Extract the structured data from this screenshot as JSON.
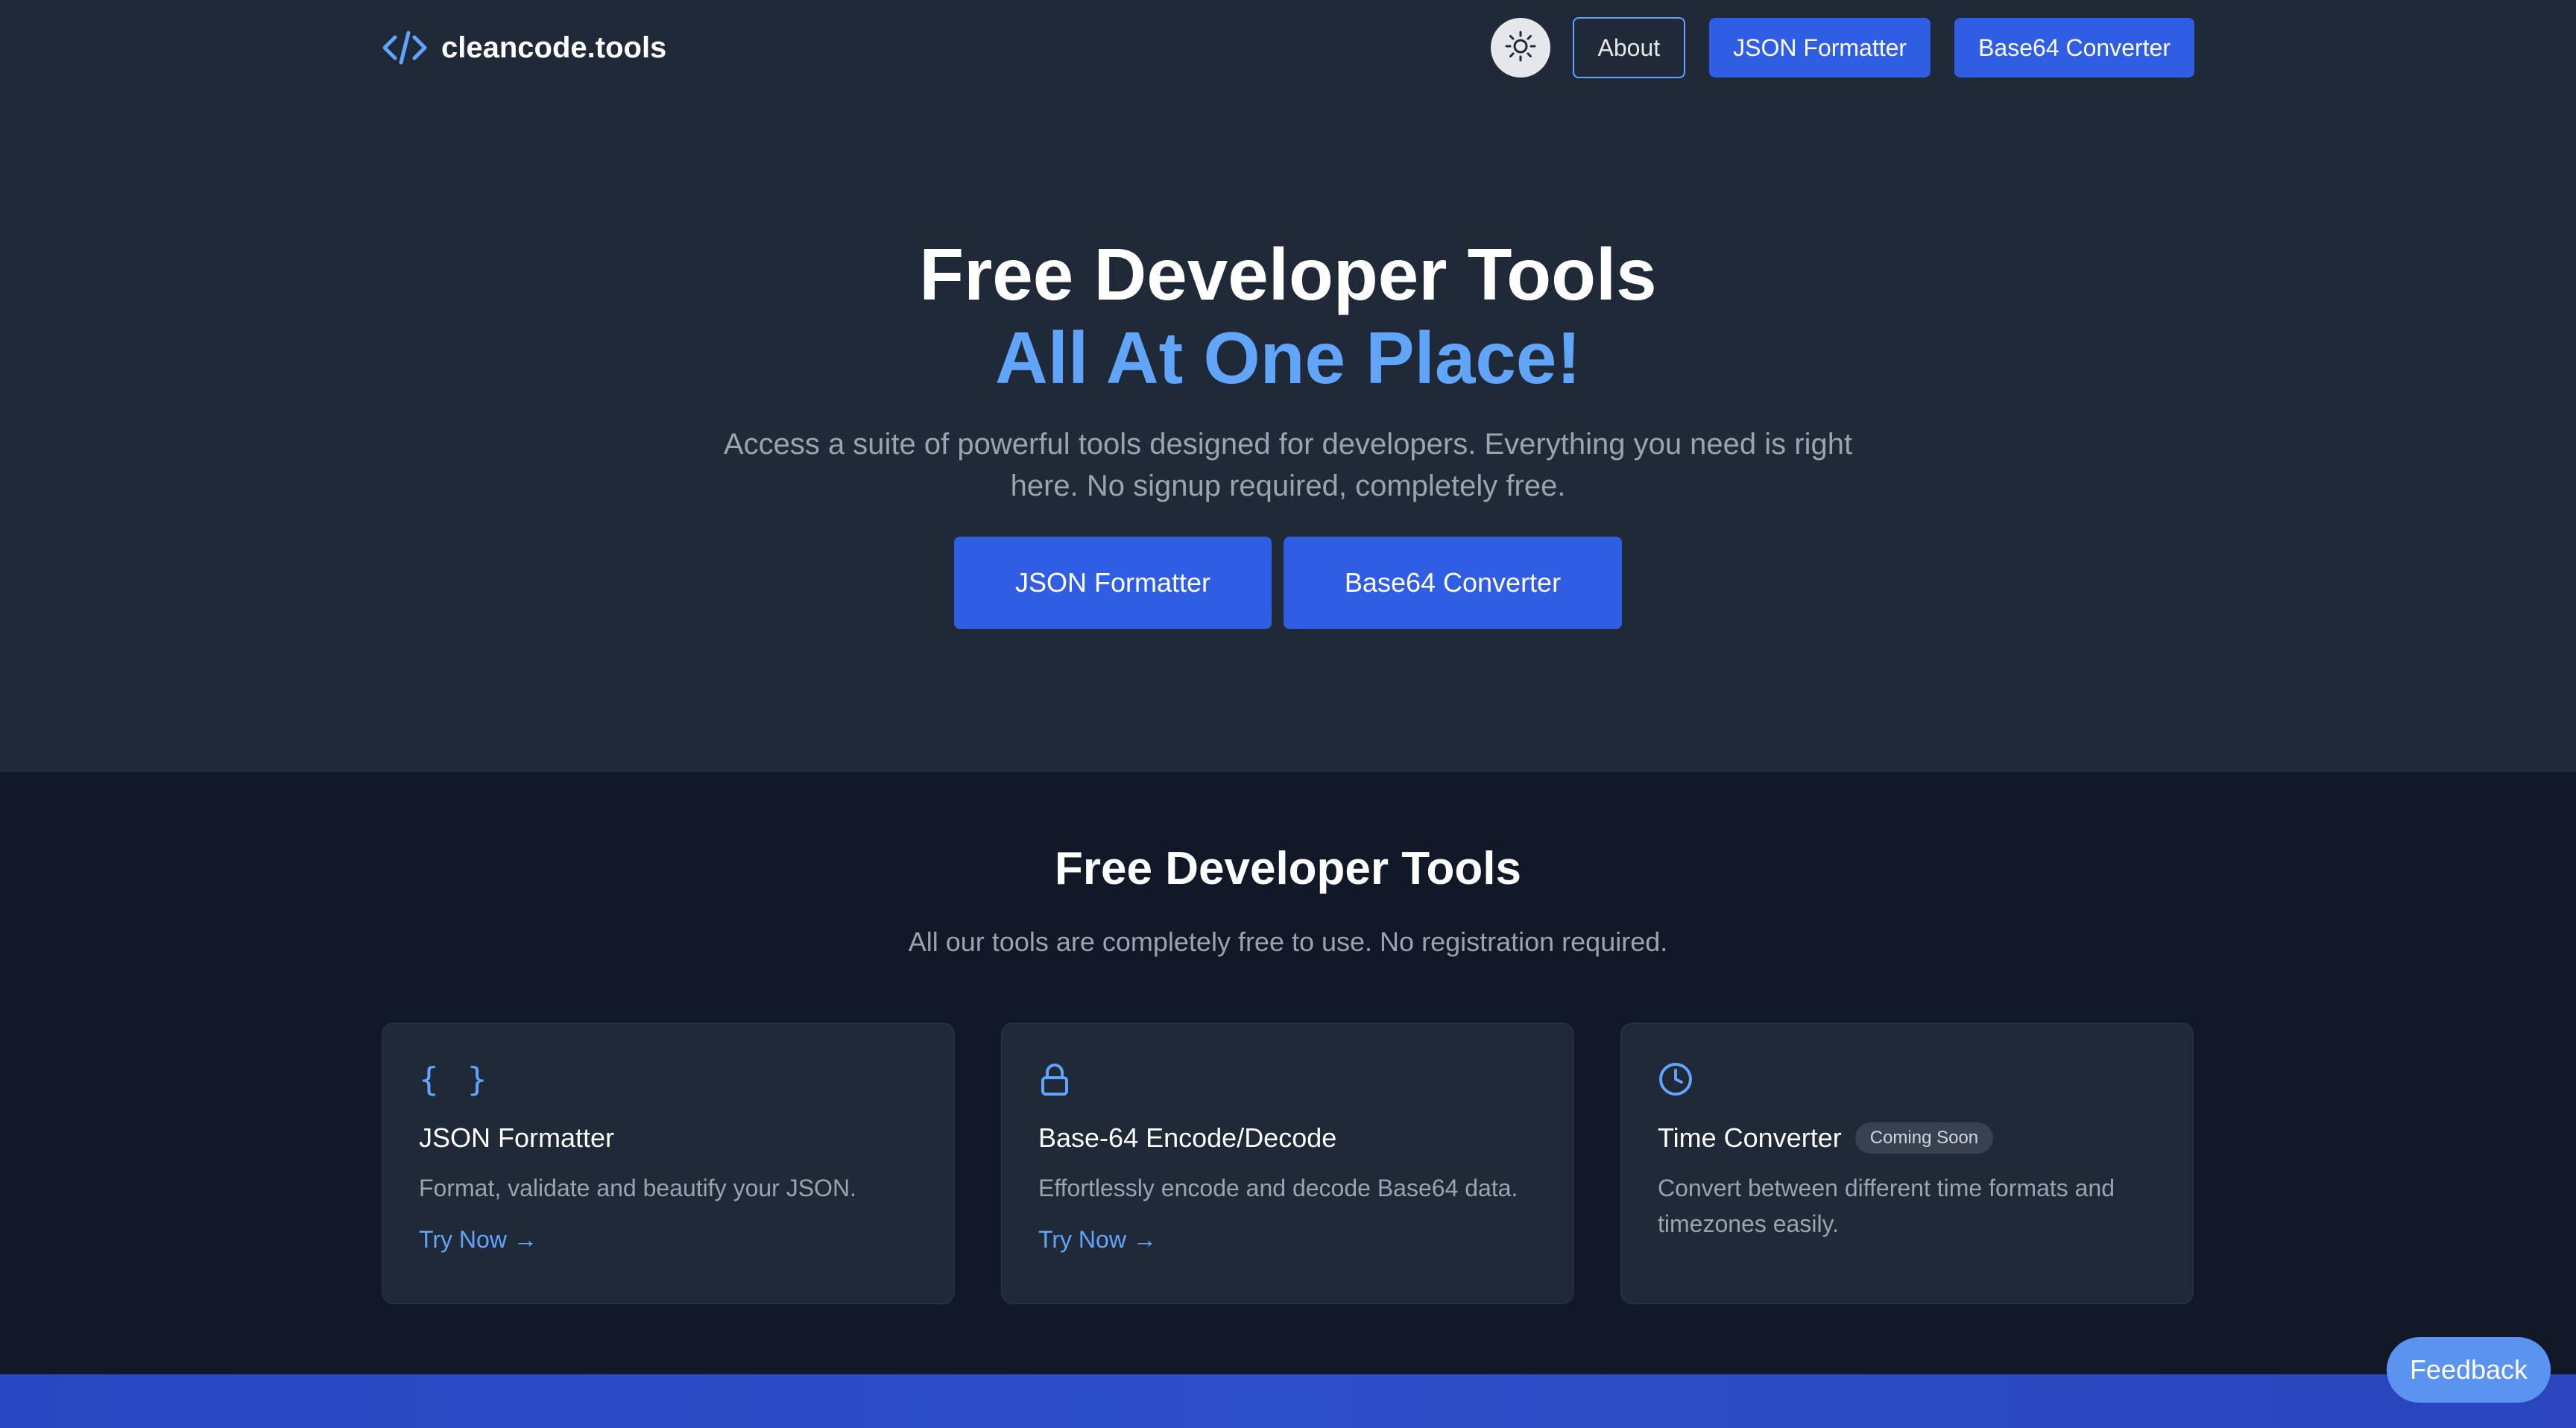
{
  "brand": {
    "name": "cleancode.tools",
    "icon": "code-brackets-icon",
    "accent": "#60a5fa"
  },
  "nav": {
    "theme_toggle_icon": "sun-icon",
    "about": "About",
    "json_formatter": "JSON Formatter",
    "base64_converter": "Base64 Converter"
  },
  "hero": {
    "title": "Free Developer Tools",
    "accent": "All At One Place!",
    "subtitle": "Access a suite of powerful tools designed for developers. Everything you need is right here. No signup required, completely free.",
    "cta_primary": "JSON Formatter",
    "cta_secondary": "Base64 Converter"
  },
  "tools": {
    "title": "Free Developer Tools",
    "subtitle": "All our tools are completely free to use. No registration required.",
    "cards": [
      {
        "icon": "braces-icon",
        "icon_glyph": "{ }",
        "title": "JSON Formatter",
        "description": "Format, validate and beautify your JSON.",
        "link": "Try Now →"
      },
      {
        "icon": "lock-icon",
        "title": "Base-64 Encode/Decode",
        "description": "Effortlessly encode and decode Base64 data.",
        "link": "Try Now →"
      },
      {
        "icon": "clock-icon",
        "title": "Time Converter",
        "badge": "Coming Soon",
        "description": "Convert between different time formats and timezones easily."
      }
    ]
  },
  "feedback": {
    "label": "Feedback"
  },
  "colors": {
    "header_bg": "#1f2937",
    "page_bg": "#111827",
    "primary_button": "#2f5ee5",
    "band": "#2e4fca"
  }
}
